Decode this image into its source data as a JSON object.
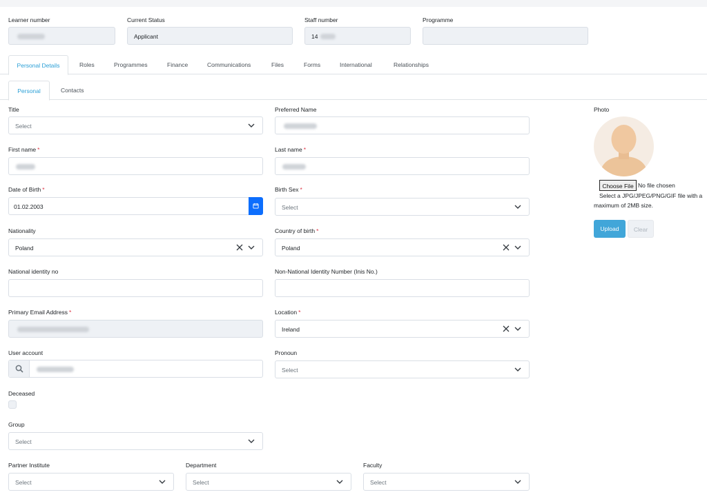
{
  "header": {
    "learner_number_label": "Learner number",
    "current_status_label": "Current Status",
    "current_status_value": "Applicant",
    "staff_number_label": "Staff number",
    "staff_number_value": "14",
    "programme_label": "Programme"
  },
  "tabs": [
    "Personal Details",
    "Roles",
    "Programmes",
    "Finance",
    "Communications",
    "Files",
    "Forms",
    "International",
    "Relationships"
  ],
  "subtabs": [
    "Personal",
    "Contacts"
  ],
  "form": {
    "title_label": "Title",
    "title_value": "Select",
    "preferred_name_label": "Preferred Name",
    "first_name_label": "First name",
    "last_name_label": "Last name",
    "dob_label": "Date of Birth",
    "dob_value": "01.02.2003",
    "birth_sex_label": "Birth Sex",
    "birth_sex_value": "Select",
    "nationality_label": "Nationality",
    "nationality_value": "Poland",
    "country_of_birth_label": "Country of birth",
    "country_of_birth_value": "Poland",
    "national_id_label": "National identity no",
    "non_national_id_label": "Non-National Identity Number (Inis No.)",
    "primary_email_label": "Primary Email Address",
    "location_label": "Location",
    "location_value": "Ireland",
    "user_account_label": "User account",
    "pronoun_label": "Pronoun",
    "pronoun_value": "Select",
    "deceased_label": "Deceased",
    "group_label": "Group",
    "group_value": "Select",
    "partner_institute_label": "Partner Institute",
    "partner_institute_value": "Select",
    "department_label": "Department",
    "department_value": "Select",
    "faculty_label": "Faculty",
    "faculty_value": "Select",
    "required_mark": "*"
  },
  "photo": {
    "label": "Photo",
    "choose_file": "Choose File",
    "no_file": "No file chosen",
    "hint_line1": "Select a JPG/JPEG/PNG/GIF file with a",
    "hint_line2": "maximum of 2MB size.",
    "upload": "Upload",
    "clear": "Clear"
  },
  "colors": {
    "accent": "#2a9fd6",
    "primary": "#0d6efd",
    "upload_button": "#41a6d9",
    "required": "#dc3545",
    "readonly_bg": "#eef1f5"
  }
}
